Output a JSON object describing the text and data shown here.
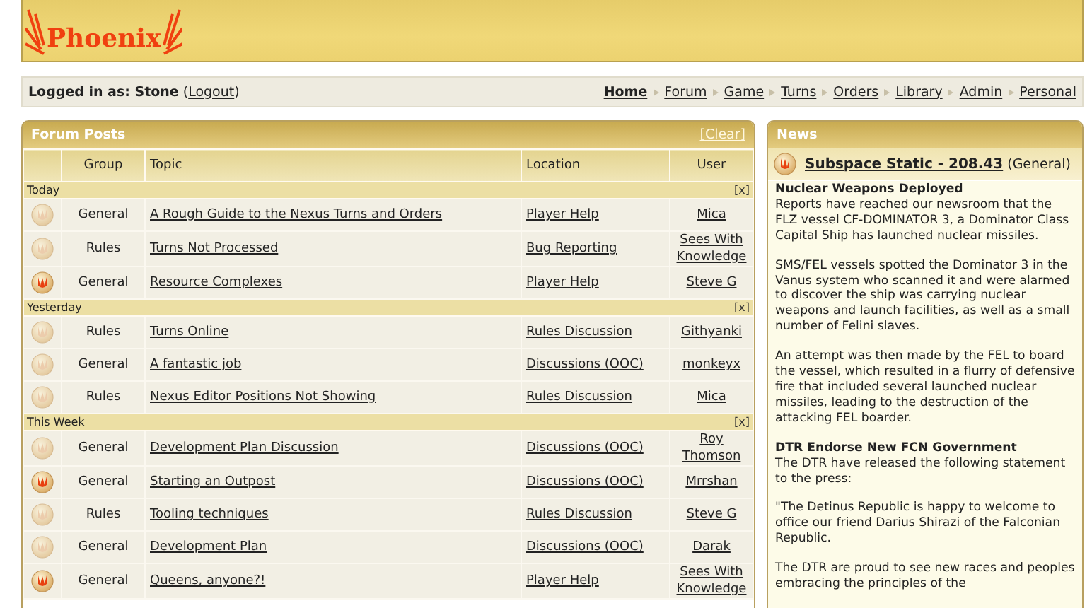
{
  "logo": {
    "text": "Phoenix"
  },
  "login": {
    "prefix": "**Logged in as: Stone** (",
    "link": "Logout",
    "suffix": ")"
  },
  "nav": [
    {
      "label": "Home",
      "selected": true
    },
    {
      "label": "Forum",
      "selected": false
    },
    {
      "label": "Game",
      "selected": false
    },
    {
      "label": "Turns",
      "selected": false
    },
    {
      "label": "Orders",
      "selected": false
    },
    {
      "label": "Library",
      "selected": false
    },
    {
      "label": "Admin",
      "selected": false
    },
    {
      "label": "Personal",
      "selected": false
    }
  ],
  "forum": {
    "title": "Forum Posts",
    "clear": "[Clear]",
    "columns": [
      "Group",
      "Topic",
      "Location",
      "User"
    ],
    "groups": [
      {
        "label": "Today",
        "close": "[x]",
        "rows": [
          {
            "unread": false,
            "group": "General",
            "topic": "A Rough Guide to the Nexus Turns and Orders",
            "location": "Player Help",
            "user": "Mica"
          },
          {
            "unread": false,
            "group": "Rules",
            "topic": "Turns Not Processed",
            "location": "Bug Reporting",
            "user": "Sees With Knowledge"
          },
          {
            "unread": true,
            "group": "General",
            "topic": "Resource Complexes",
            "location": "Player Help",
            "user": "Steve G"
          }
        ]
      },
      {
        "label": "Yesterday",
        "close": "[x]",
        "rows": [
          {
            "unread": false,
            "group": "Rules",
            "topic": "Turns Online",
            "location": "Rules Discussion",
            "user": "Githyanki"
          },
          {
            "unread": false,
            "group": "General",
            "topic": "A fantastic job",
            "location": "Discussions (OOC)",
            "user": "monkeyx"
          },
          {
            "unread": false,
            "group": "Rules",
            "topic": "Nexus Editor Positions Not Showing",
            "location": "Rules Discussion",
            "user": "Mica"
          }
        ]
      },
      {
        "label": "This Week",
        "close": "[x]",
        "rows": [
          {
            "unread": false,
            "group": "General",
            "topic": "Development Plan Discussion",
            "location": "Discussions (OOC)",
            "user": "Roy Thomson"
          },
          {
            "unread": true,
            "group": "General",
            "topic": "Starting an Outpost",
            "location": "Discussions (OOC)",
            "user": "Mrrshan"
          },
          {
            "unread": false,
            "group": "Rules",
            "topic": "Tooling techniques",
            "location": "Rules Discussion",
            "user": "Steve G"
          },
          {
            "unread": false,
            "group": "General",
            "topic": "Development Plan",
            "location": "Discussions (OOC)",
            "user": "Darak"
          },
          {
            "unread": true,
            "group": "General",
            "topic": "Queens, anyone?!",
            "location": "Player Help",
            "user": "Sees With Knowledge"
          }
        ]
      }
    ]
  },
  "news": {
    "title": "News",
    "item": {
      "unread": true,
      "headline": "Subspace Static - 208.43",
      "category": "(General)"
    },
    "articles": [
      {
        "title": "Nuclear Weapons Deployed",
        "paragraphs": [
          "Reports have reached our newsroom that the FLZ vessel CF-DOMINATOR 3, a Dominator Class Capital Ship has launched nuclear missiles.",
          "SMS/FEL vessels spotted the Dominator 3 in the Vanus system who scanned it and were alarmed to discover the ship was carrying nuclear weapons and launch facilities, as well as a small number of Felini slaves.",
          "An attempt was then made by the FEL to board the vessel, which resulted in a flurry of defensive fire that included several launched nuclear missiles, leading to the destruction of the attacking FEL boarder."
        ]
      },
      {
        "title": "DTR Endorse New FCN Government",
        "paragraphs": [
          "The DTR have released the following statement to the press:",
          "\"The Detinus Republic is happy to welcome to office our friend Darius Shirazi of the Falconian Republic.",
          "The DTR are proud to see new races and peoples embracing the principles of the"
        ]
      }
    ]
  }
}
